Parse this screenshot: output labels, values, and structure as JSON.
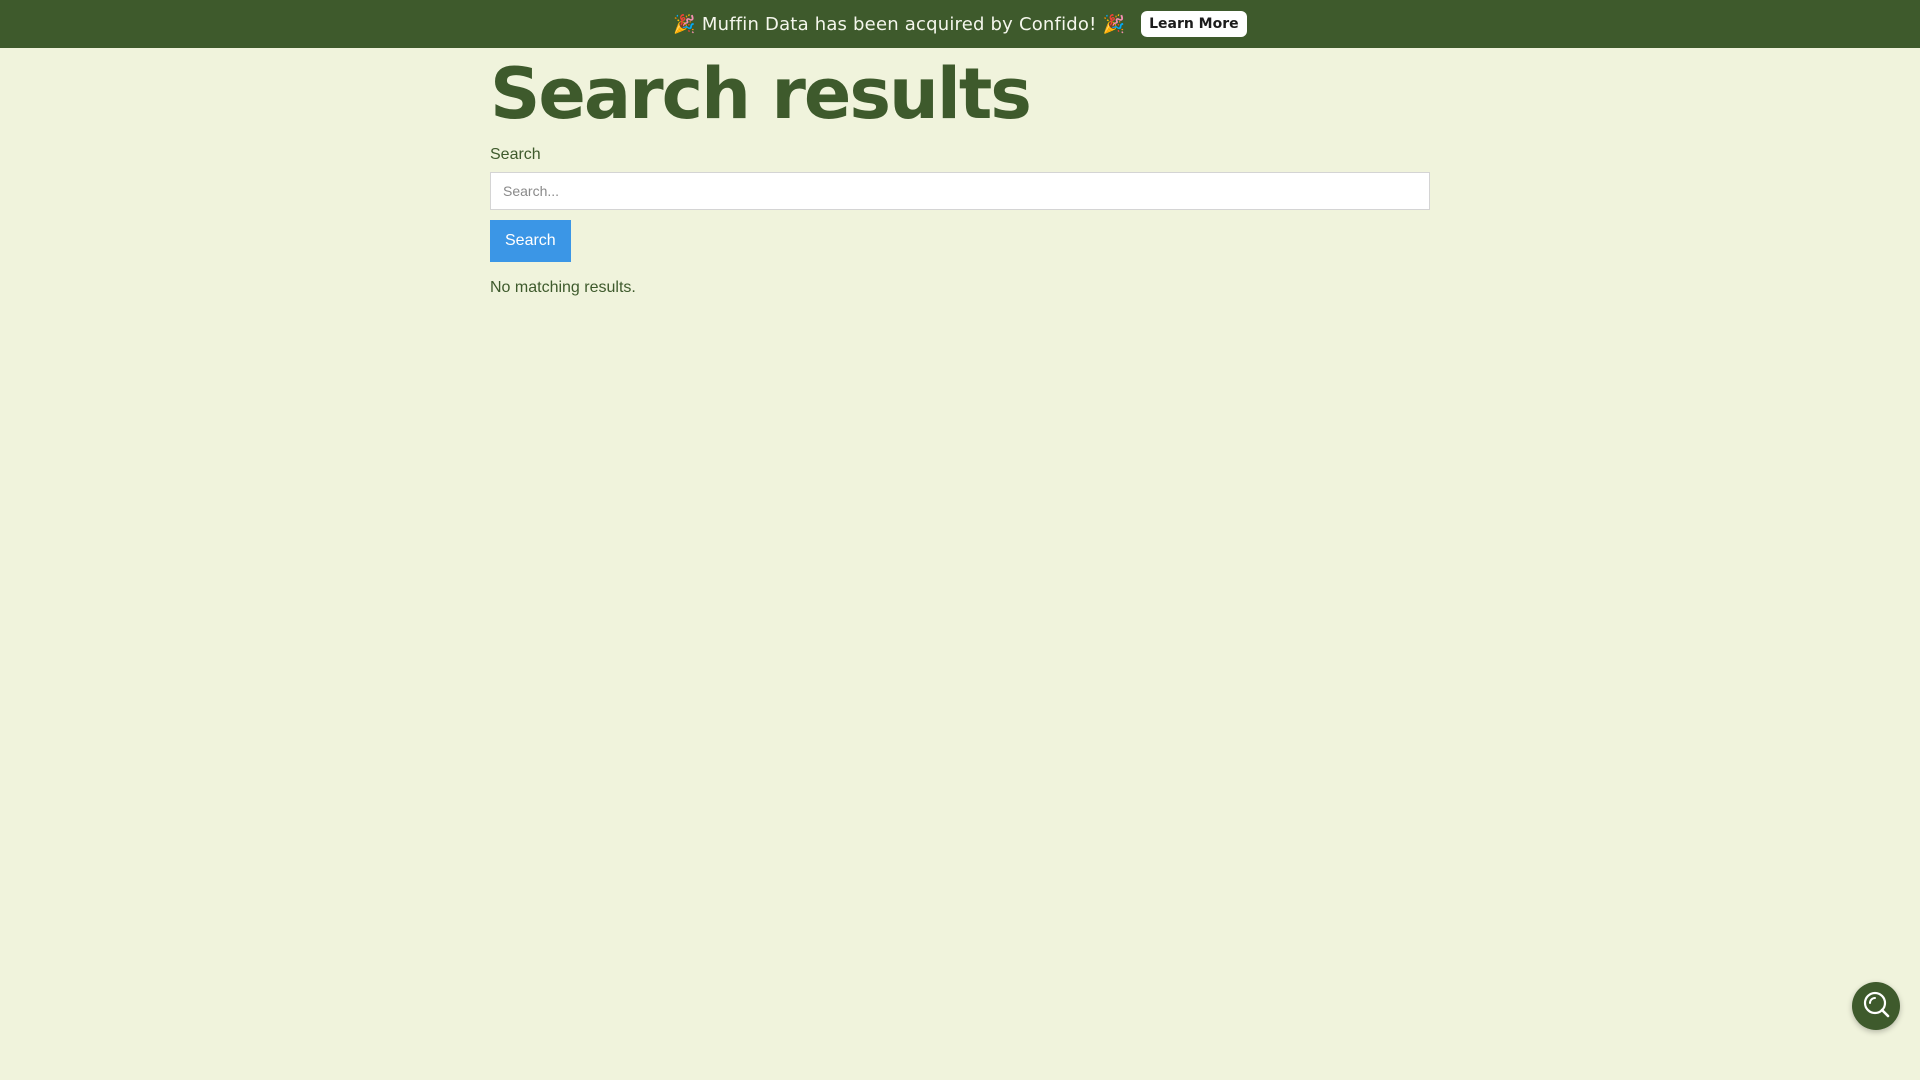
{
  "banner": {
    "message": "🎉 Muffin Data has been acquired by Confido! 🎉",
    "learn_more_label": "Learn More"
  },
  "page": {
    "title": "Search results"
  },
  "search": {
    "label": "Search",
    "placeholder": "Search...",
    "value": "",
    "button_label": "Search"
  },
  "results": {
    "empty_message": "No matching results."
  },
  "help_widget": {
    "icon": "chat-search-icon"
  },
  "colors": {
    "brand_green": "#3e5a2c",
    "background": "#f0f3dc",
    "button_blue": "#3b96e6"
  }
}
